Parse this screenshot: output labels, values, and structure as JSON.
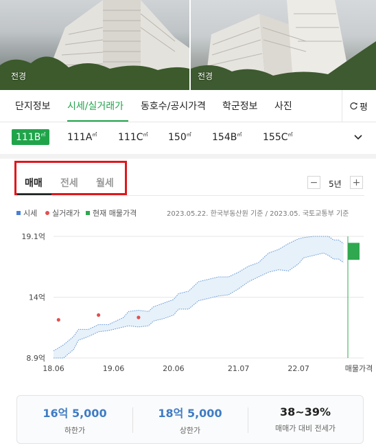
{
  "photos": [
    {
      "caption": "전경"
    },
    {
      "caption": "전경"
    }
  ],
  "tabs": [
    "단지정보",
    "시세/실거래가",
    "동호수/공시가격",
    "학군정보",
    "사진"
  ],
  "active_tab": "시세/실거래가",
  "more_tab_label": "평",
  "areas": [
    "111B",
    "111A",
    "111C",
    "150",
    "154B",
    "155C"
  ],
  "area_unit_sup": "㎡",
  "active_area": "111B",
  "deal_types": [
    "매매",
    "전세",
    "월세"
  ],
  "active_deal": "매매",
  "period": {
    "label": "5년",
    "minus": "−",
    "plus": "+"
  },
  "legend": [
    {
      "label": "시세",
      "color": "#4a7fd6"
    },
    {
      "label": "실거래가",
      "color": "#e05050"
    },
    {
      "label": "현재 매물가격",
      "color": "#2fa84f"
    }
  ],
  "source_note": "2023.05.22. 한국부동산원 기준 / 2023.05. 국토교통부 기준",
  "chart_data": {
    "type": "line",
    "y_ticks": [
      "19.1억",
      "14억",
      "8.9억"
    ],
    "ylim": [
      8.9,
      19.1
    ],
    "x_ticks": [
      "18.06",
      "19.06",
      "20.06",
      "21.07",
      "22.07",
      "매물가격"
    ],
    "x_tick_months": [
      0,
      12,
      24,
      37,
      49
    ],
    "x_total_months": 59,
    "series": [
      {
        "name": "시세",
        "upper_x": [
          0,
          2,
          4,
          5,
          7,
          9,
          11,
          14,
          15,
          17,
          19,
          20,
          22,
          24,
          25,
          27,
          29,
          31,
          33,
          35,
          37,
          39,
          41,
          43,
          45,
          47,
          49,
          50,
          52,
          54,
          55,
          56,
          57,
          58
        ],
        "upper": [
          9.5,
          10.0,
          10.7,
          11.3,
          11.3,
          11.7,
          11.7,
          12.3,
          12.8,
          12.9,
          12.8,
          13.2,
          13.5,
          13.8,
          14.3,
          14.5,
          15.3,
          15.5,
          15.7,
          15.7,
          16.1,
          16.6,
          16.9,
          17.7,
          18.0,
          18.5,
          18.9,
          19.0,
          19.1,
          19.1,
          19.1,
          18.8,
          18.8,
          18.5
        ],
        "lower_x": [
          0,
          2,
          4,
          5,
          7,
          9,
          11,
          14,
          15,
          17,
          19,
          20,
          22,
          24,
          25,
          27,
          29,
          31,
          33,
          35,
          37,
          39,
          41,
          43,
          45,
          47,
          49,
          50,
          52,
          54,
          55,
          56,
          57,
          58
        ],
        "lower": [
          8.9,
          8.9,
          9.6,
          10.4,
          10.7,
          11.1,
          11.2,
          11.5,
          11.6,
          11.5,
          11.6,
          12.0,
          12.2,
          12.5,
          13.0,
          13.0,
          13.7,
          13.9,
          14.1,
          14.2,
          14.7,
          15.3,
          15.7,
          16.1,
          16.3,
          16.2,
          16.8,
          17.3,
          17.5,
          17.7,
          17.5,
          17.2,
          17.2,
          16.9
        ]
      }
    ],
    "transactions": [
      {
        "month": 1,
        "value": 12.1
      },
      {
        "month": 9,
        "value": 12.5
      },
      {
        "month": 17,
        "value": 12.3
      }
    ],
    "listing": {
      "low": 16.5,
      "high": 18.5
    }
  },
  "summary": [
    {
      "value": "16억 5,000",
      "label": "하한가",
      "color": "#3f7cc4"
    },
    {
      "value": "18억 5,000",
      "label": "상한가",
      "color": "#3f7cc4"
    },
    {
      "value": "38~39%",
      "label": "매매가 대비 전세가",
      "color": "#222222"
    }
  ]
}
